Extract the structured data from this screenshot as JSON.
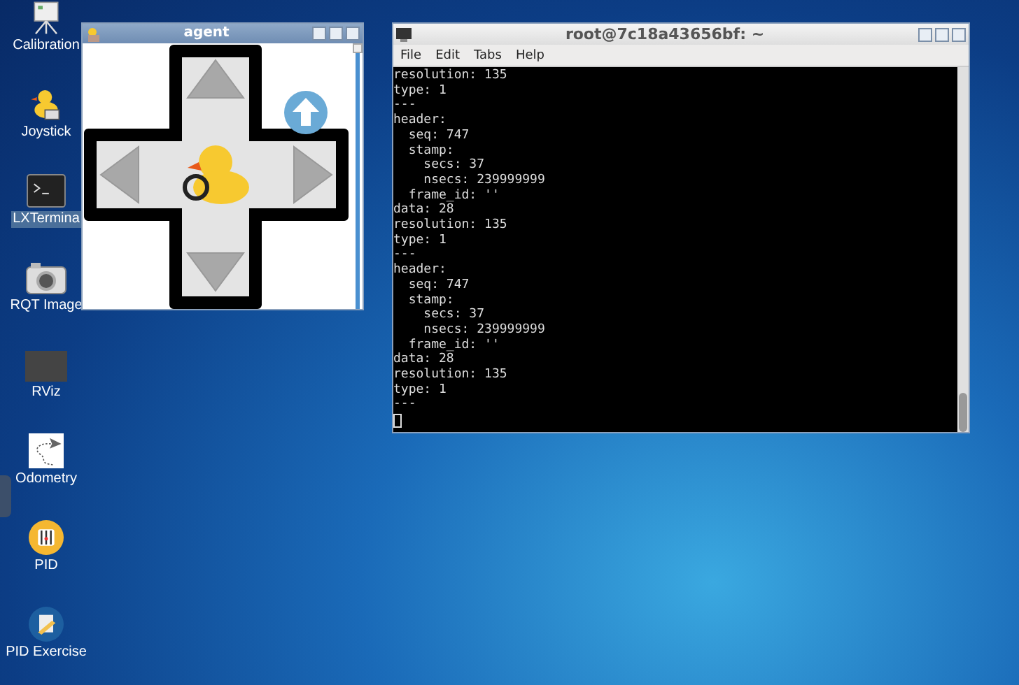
{
  "desktop_icons": [
    {
      "label": "Calibration",
      "kind": "calibration",
      "selected": false
    },
    {
      "label": "Joystick",
      "kind": "joystick",
      "selected": false
    },
    {
      "label": "LXTermina",
      "kind": "terminal",
      "selected": true
    },
    {
      "label": "RQT Image",
      "kind": "camera",
      "selected": false
    },
    {
      "label": "RViz",
      "kind": "rviz",
      "selected": false
    },
    {
      "label": "Odometry",
      "kind": "odometry",
      "selected": false
    },
    {
      "label": "PID",
      "kind": "pid",
      "selected": false
    },
    {
      "label": "PID Exercise",
      "kind": "exercise",
      "selected": false
    }
  ],
  "agent_window": {
    "title": "agent"
  },
  "terminal": {
    "title": "root@7c18a43656bf: ~",
    "menu": [
      "File",
      "Edit",
      "Tabs",
      "Help"
    ],
    "lines": [
      "resolution: 135",
      "type: 1",
      "---",
      "header:",
      "  seq: 747",
      "  stamp:",
      "    secs: 37",
      "    nsecs: 239999999",
      "  frame_id: ''",
      "data: 28",
      "resolution: 135",
      "type: 1",
      "---",
      "header:",
      "  seq: 747",
      "  stamp:",
      "    secs: 37",
      "    nsecs: 239999999",
      "  frame_id: ''",
      "data: 28",
      "resolution: 135",
      "type: 1",
      "---"
    ]
  }
}
